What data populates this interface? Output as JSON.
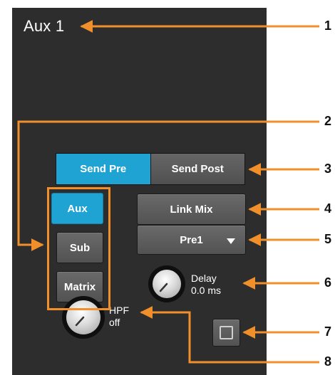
{
  "title": "Aux 1",
  "send": {
    "pre_label": "Send Pre",
    "post_label": "Send Post",
    "active": "pre"
  },
  "bus_buttons": [
    {
      "label": "Aux",
      "active": true
    },
    {
      "label": "Sub",
      "active": false
    },
    {
      "label": "Matrix",
      "active": false
    }
  ],
  "link_mix_label": "Link Mix",
  "tap_select": {
    "value": "Pre1"
  },
  "delay": {
    "label": "Delay",
    "value": "0.0 ms"
  },
  "hpf": {
    "label": "HPF",
    "value": "off"
  },
  "callouts": [
    "1",
    "2",
    "3",
    "4",
    "5",
    "6",
    "7",
    "8"
  ],
  "colors": {
    "panel": "#2d2d2d",
    "accent_blue": "#1fa3d3",
    "callout_orange": "#f1902a",
    "button_gray": "#5e5e5e"
  }
}
